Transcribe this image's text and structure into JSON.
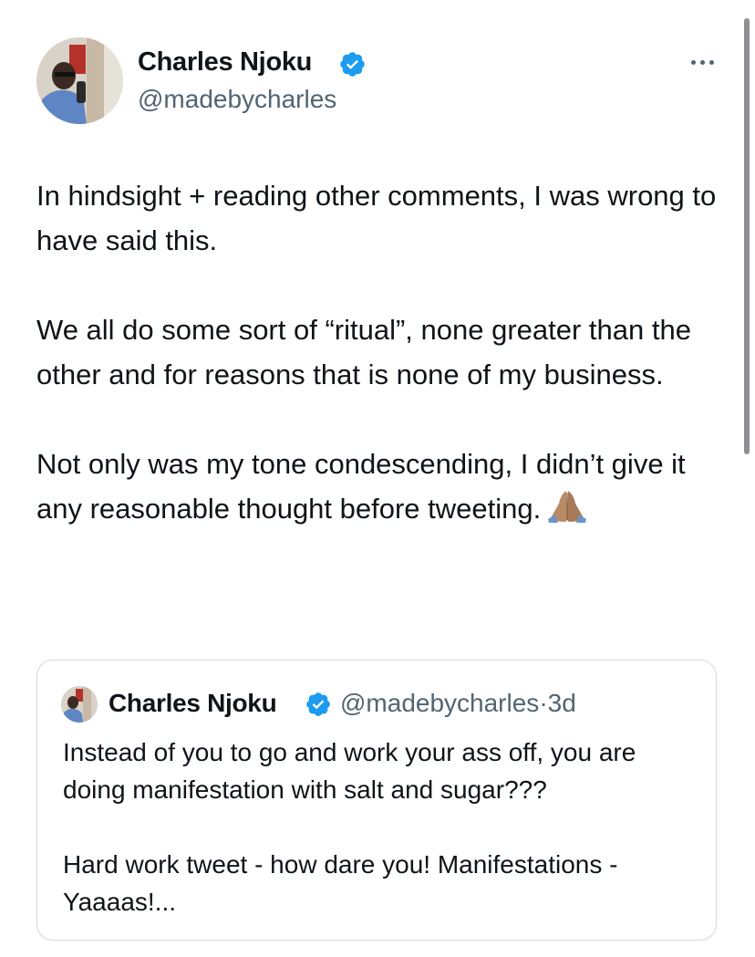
{
  "tweet": {
    "author": {
      "display_name": "Charles Njoku",
      "handle": "@madebycharles",
      "verified": true,
      "verified_color": "#1d9bf0"
    },
    "more_icon": "more-horizontal-icon",
    "paragraphs": [
      "In hindsight + reading other comments, I was wrong to have said this.",
      "We all do some sort of “ritual”, none greater than the other and for reasons that is none of my business.",
      "Not only was my tone condescending, I didn’t give it any reasonable thought before tweeting."
    ],
    "emoji": "folded-hands-emoji"
  },
  "quoted_tweet": {
    "display_name": "Charles Njoku",
    "handle": "@madebycharles",
    "separator": "·",
    "time": "3d",
    "paragraphs": [
      "Instead of you to go and work your ass off, you are doing manifestation with salt and sugar???",
      "Hard work tweet - how dare you! Manifestations - Yaaaas!..."
    ]
  },
  "colors": {
    "text": "#0f1419",
    "secondary": "#536471",
    "border": "#cfd9de",
    "verified": "#1d9bf0"
  }
}
